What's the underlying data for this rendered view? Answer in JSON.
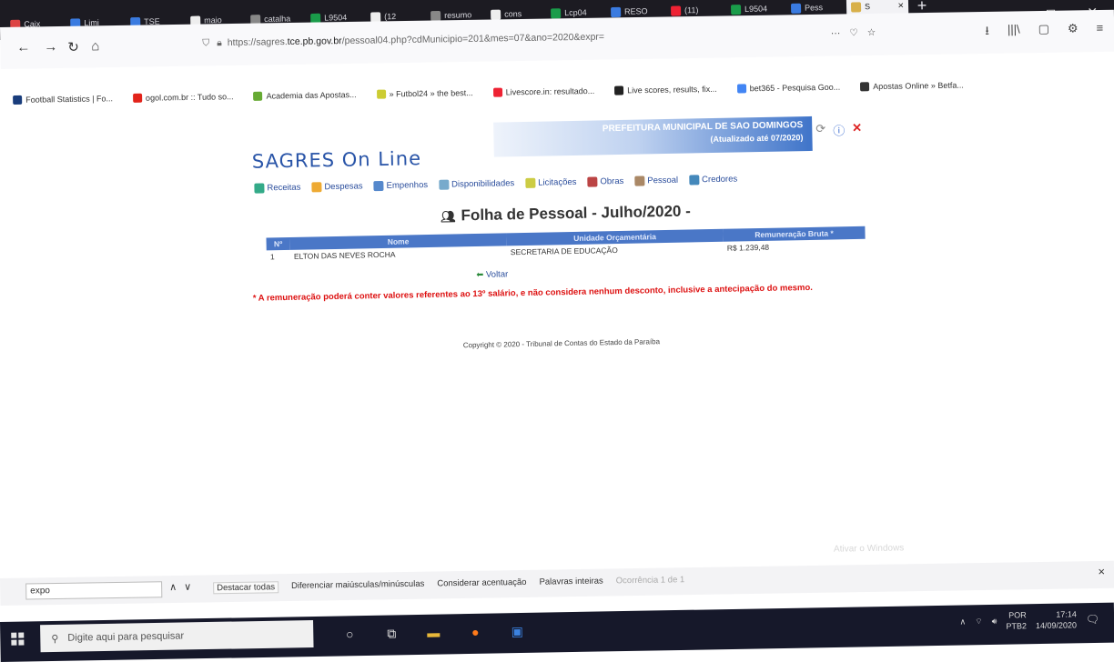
{
  "browser": {
    "tabs": [
      {
        "label": "Caix",
        "color": "#d44"
      },
      {
        "label": "Limi",
        "color": "#3a7be0"
      },
      {
        "label": "TSE",
        "color": "#3a7be0"
      },
      {
        "label": "maio",
        "color": "#eee"
      },
      {
        "label": "catalha",
        "color": "#888"
      },
      {
        "label": "L9504",
        "color": "#1a9c4a"
      },
      {
        "label": "(12",
        "color": "#eee"
      },
      {
        "label": "resumo",
        "color": "#888"
      },
      {
        "label": "cons",
        "color": "#eee"
      },
      {
        "label": "Lcp04",
        "color": "#1a9c4a"
      },
      {
        "label": "RESO",
        "color": "#3a7be0"
      },
      {
        "label": "(11)",
        "color": "#e23"
      },
      {
        "label": "L9504",
        "color": "#1a9c4a"
      },
      {
        "label": "Pess",
        "color": "#3a7be0"
      }
    ],
    "active_tab": {
      "label": "S",
      "close": "×"
    },
    "new_tab": "+",
    "window_controls": [
      "–",
      "◻",
      "✕"
    ],
    "url_prefix": "https://sagres.",
    "url_host": "tce.pb.gov.br",
    "url_path": "/pessoal04.php?cdMunicipio=201&mes=07&ano=2020&expr=",
    "url_actions": [
      "···",
      "♡",
      "☆"
    ],
    "nav_right": [
      "⭳",
      "|||\\",
      "▢",
      "⚙",
      "≡"
    ],
    "bookmarks": [
      {
        "label": "Football Statistics | Fo...",
        "color": "#1a3d7c"
      },
      {
        "label": "ogol.com.br :: Tudo so...",
        "color": "#e2231a"
      },
      {
        "label": "Academia das Apostas...",
        "color": "#6a3"
      },
      {
        "label": "» Futbol24 » the best...",
        "color": "#cc3"
      },
      {
        "label": "Livescore.in: resultado...",
        "color": "#e23"
      },
      {
        "label": "Live scores, results, fix...",
        "color": "#222"
      },
      {
        "label": "bet365 - Pesquisa Goo...",
        "color": "#4285f4"
      },
      {
        "label": "Apostas Online » Betfa...",
        "color": "#333"
      }
    ]
  },
  "page": {
    "logo": "SAGRES On Line",
    "banner_title": "PREFEITURA MUNICIPAL DE SAO DOMINGOS",
    "banner_sub": "(Atualizado até 07/2020)",
    "menu": [
      {
        "label": "Receitas",
        "color": "#3a8"
      },
      {
        "label": "Despesas",
        "color": "#ea3"
      },
      {
        "label": "Empenhos",
        "color": "#58c"
      },
      {
        "label": "Disponibilidades",
        "color": "#7ac"
      },
      {
        "label": "Licitações",
        "color": "#cc4"
      },
      {
        "label": "Obras",
        "color": "#b44"
      },
      {
        "label": "Pessoal",
        "color": "#a86"
      },
      {
        "label": "Credores",
        "color": "#48b"
      }
    ],
    "title": "Folha de Pessoal - Julho/2020 -",
    "table": {
      "headers": [
        "Nº",
        "Nome",
        "Unidade Orçamentária",
        "Remuneração Bruta *"
      ],
      "rows": [
        [
          "1",
          "ELTON DAS NEVES ROCHA",
          "SECRETARIA DE EDUCAÇÃO",
          "R$ 1.239,48"
        ]
      ]
    },
    "voltar": "Voltar",
    "note": "* A remuneração poderá conter valores referentes ao 13º salário, e não considera nenhum desconto, inclusive a antecipação do mesmo.",
    "copyright": "Copyright © 2020 - Tribunal de Contas do Estado da Paraíba"
  },
  "watermark": "Ativar o Windows",
  "findbar": {
    "value": "expo",
    "up": "∧",
    "down": "∨",
    "highlight_all": "Destacar todas",
    "match_case": "Diferenciar maiúsculas/minúsculas",
    "match_diacritics": "Considerar acentuação",
    "whole_words": "Palavras inteiras",
    "status": "Ocorrência 1 de 1",
    "close": "×"
  },
  "taskbar": {
    "search_placeholder": "Digite aqui para pesquisar",
    "lang": "POR",
    "layout": "PTB2",
    "time": "17:14",
    "date": "14/09/2020"
  }
}
